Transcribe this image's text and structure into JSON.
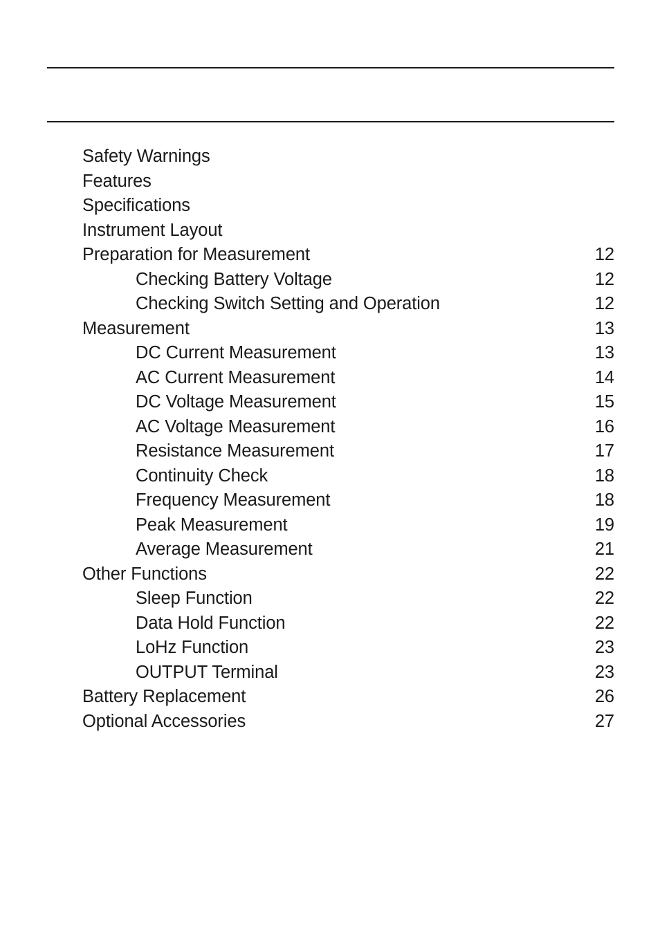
{
  "document": {
    "header_title": "",
    "rule_color": "#1a1a1a",
    "text_color": "#1a1a1a",
    "background_color": "#ffffff"
  },
  "toc": {
    "entries": [
      {
        "label": "Safety Warnings",
        "page": "",
        "level": 1
      },
      {
        "label": "Features",
        "page": "",
        "level": 1
      },
      {
        "label": "Specifications",
        "page": "",
        "level": 1
      },
      {
        "label": "Instrument Layout",
        "page": "",
        "level": 1
      },
      {
        "label": "Preparation for Measurement",
        "page": "12",
        "level": 1
      },
      {
        "label": "Checking Battery Voltage",
        "page": "12",
        "level": 2
      },
      {
        "label": "Checking Switch Setting and Operation",
        "page": "12",
        "level": 2
      },
      {
        "label": "Measurement",
        "page": "13",
        "level": 1
      },
      {
        "label": "DC Current Measurement",
        "page": "13",
        "level": 2
      },
      {
        "label": "AC Current Measurement",
        "page": "14",
        "level": 2
      },
      {
        "label": "DC Voltage Measurement",
        "page": "15",
        "level": 2
      },
      {
        "label": "AC Voltage Measurement",
        "page": "16",
        "level": 2
      },
      {
        "label": "Resistance Measurement",
        "page": "17",
        "level": 2
      },
      {
        "label": "Continuity Check",
        "page": "18",
        "level": 2
      },
      {
        "label": "Frequency Measurement",
        "page": "18",
        "level": 2
      },
      {
        "label": "Peak Measurement",
        "page": "19",
        "level": 2
      },
      {
        "label": "Average Measurement",
        "page": "21",
        "level": 2
      },
      {
        "label": "Other Functions",
        "page": "22",
        "level": 1
      },
      {
        "label": "Sleep Function",
        "page": "22",
        "level": 2
      },
      {
        "label": "Data Hold Function",
        "page": "22",
        "level": 2
      },
      {
        "label": "LoHz Function",
        "page": "23",
        "level": 2
      },
      {
        "label": "OUTPUT Terminal",
        "page": "23",
        "level": 2
      },
      {
        "label": "Battery Replacement",
        "page": "26",
        "level": 1
      },
      {
        "label": "Optional Accessories",
        "page": "27",
        "level": 1
      }
    ]
  }
}
